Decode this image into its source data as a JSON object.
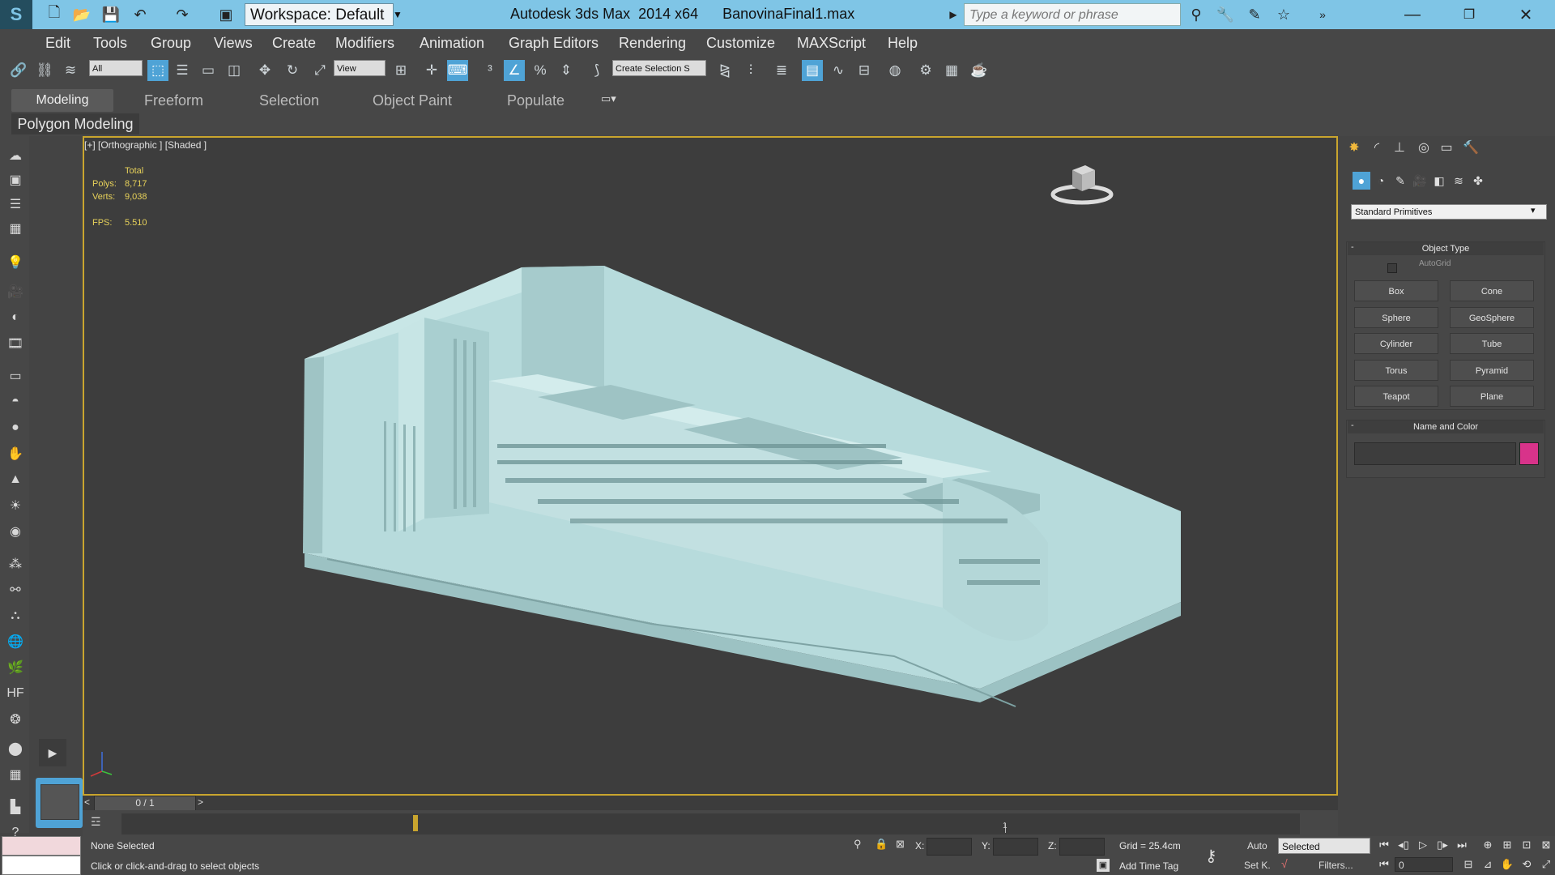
{
  "titlebar": {
    "workspace_label": "Workspace: Default",
    "title": "Autodesk 3ds Max  2014 x64      BanovinaFinal1.max",
    "search_placeholder": "Type a keyword or phrase"
  },
  "menu": [
    "Edit",
    "Tools",
    "Group",
    "Views",
    "Create",
    "Modifiers",
    "Animation",
    "Graph Editors",
    "Rendering",
    "Customize",
    "MAXScript",
    "Help"
  ],
  "toolbar": {
    "filter_value": "All",
    "ref_coord_value": "View",
    "selection_set_value": "Create Selection S"
  },
  "ribbon": {
    "tabs": [
      "Modeling",
      "Freeform",
      "Selection",
      "Object Paint",
      "Populate"
    ],
    "panel_label": "Polygon Modeling"
  },
  "viewport": {
    "label": "[+] [Orthographic ] [Shaded ]",
    "stats": {
      "total_label": "Total",
      "polys_label": "Polys:",
      "polys_value": "8,717",
      "verts_label": "Verts:",
      "verts_value": "9,038",
      "fps_label": "FPS:",
      "fps_value": "5.510"
    },
    "model_color": "#b8dcdc"
  },
  "timeline": {
    "frame_label": "0 / 1",
    "prev": "<",
    "next": ">",
    "track_number": "1"
  },
  "status": {
    "selection_text": "None Selected",
    "prompt_text": "Click or click-and-drag to select objects",
    "x_label": "X:",
    "y_label": "Y:",
    "z_label": "Z:",
    "grid_text": "Grid = 25.4cm",
    "add_time_tag": "Add Time Tag",
    "auto_label": "Auto",
    "setk_label": "Set K.",
    "selected_value": "Selected",
    "filters_label": "Filters...",
    "frame_value": "0"
  },
  "command_panel": {
    "category_value": "Standard Primitives",
    "object_type_title": "Object Type",
    "autogrid_label": "AutoGrid",
    "primitives": [
      "Box",
      "Cone",
      "Sphere",
      "GeoSphere",
      "Cylinder",
      "Tube",
      "Torus",
      "Pyramid",
      "Teapot",
      "Plane"
    ],
    "name_color_title": "Name and Color",
    "swatch_color": "#d8338a"
  }
}
